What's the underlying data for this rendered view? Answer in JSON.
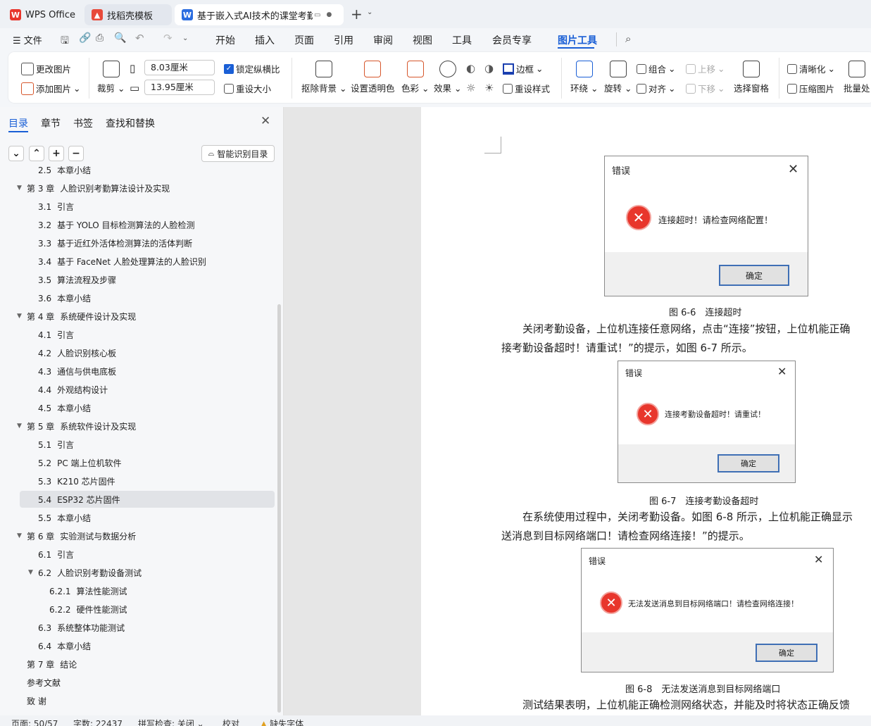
{
  "tabs": [
    {
      "label": "WPS Office",
      "icon": "wps-logo-icon"
    },
    {
      "label": "找稻壳模板",
      "icon": "docer-icon"
    },
    {
      "label": "基于嵌入式AI技术的课堂考勤",
      "icon": "word-doc-icon"
    }
  ],
  "menu": [
    "文件",
    "开始",
    "插入",
    "页面",
    "引用",
    "审阅",
    "视图",
    "工具",
    "会员专享",
    "图片工具"
  ],
  "ribbon": {
    "change_image": "更改图片",
    "add_image": "添加图片",
    "crop": "裁剪",
    "width": "8.03厘米",
    "height": "13.95厘米",
    "lock_ratio": "锁定纵横比",
    "reset_size": "重设大小",
    "remove_bg": "抠除背景",
    "set_transparent": "设置透明色",
    "color": "色彩",
    "effect": "效果",
    "border": "边框",
    "reset_style": "重设样式",
    "wrap": "环绕",
    "rotate": "旋转",
    "group": "组合",
    "align": "对齐",
    "bring_forward": "上移",
    "send_backward": "下移",
    "selection_pane": "选择窗格",
    "sharpen": "清晰化",
    "compress": "压缩图片",
    "batch": "批量处"
  },
  "sidebar": {
    "tabs": [
      "目录",
      "章节",
      "书签",
      "查找和替换"
    ],
    "smart_btn": "智能识别目录",
    "items": [
      {
        "num": "2.5",
        "text": "本章小结",
        "level": 1
      },
      {
        "num": "第 3 章",
        "text": "人脸识别考勤算法设计及实现",
        "level": 0,
        "expanded": true
      },
      {
        "num": "3.1",
        "text": "引言",
        "level": 1
      },
      {
        "num": "3.2",
        "text": "基于 YOLO 目标检测算法的人脸检测",
        "level": 1
      },
      {
        "num": "3.3",
        "text": "基于近红外活体检测算法的活体判断",
        "level": 1
      },
      {
        "num": "3.4",
        "text": "基于 FaceNet 人脸处理算法的人脸识别",
        "level": 1
      },
      {
        "num": "3.5",
        "text": "算法流程及步骤",
        "level": 1
      },
      {
        "num": "3.6",
        "text": "本章小结",
        "level": 1
      },
      {
        "num": "第 4 章",
        "text": "系统硬件设计及实现",
        "level": 0,
        "expanded": true
      },
      {
        "num": "4.1",
        "text": "引言",
        "level": 1
      },
      {
        "num": "4.2",
        "text": "人脸识别核心板",
        "level": 1
      },
      {
        "num": "4.3",
        "text": "通信与供电底板",
        "level": 1
      },
      {
        "num": "4.4",
        "text": "外观结构设计",
        "level": 1
      },
      {
        "num": "4.5",
        "text": "本章小结",
        "level": 1
      },
      {
        "num": "第 5 章",
        "text": "系统软件设计及实现",
        "level": 0,
        "expanded": true
      },
      {
        "num": "5.1",
        "text": "引言",
        "level": 1
      },
      {
        "num": "5.2",
        "text": "PC 端上位机软件",
        "level": 1
      },
      {
        "num": "5.3",
        "text": "K210 芯片固件",
        "level": 1
      },
      {
        "num": "5.4",
        "text": "ESP32 芯片固件",
        "level": 1,
        "selected": true
      },
      {
        "num": "5.5",
        "text": "本章小结",
        "level": 1
      },
      {
        "num": "第 6 章",
        "text": "实验测试与数据分析",
        "level": 0,
        "expanded": true
      },
      {
        "num": "6.1",
        "text": "引言",
        "level": 1
      },
      {
        "num": "6.2",
        "text": "人脸识别考勤设备测试",
        "level": 1,
        "expanded": true
      },
      {
        "num": "6.2.1",
        "text": "算法性能测试",
        "level": 2
      },
      {
        "num": "6.2.2",
        "text": "硬件性能测试",
        "level": 2
      },
      {
        "num": "6.3",
        "text": "系统整体功能测试",
        "level": 1
      },
      {
        "num": "6.4",
        "text": "本章小结",
        "level": 1
      },
      {
        "num": "第 7 章",
        "text": "结论",
        "level": 0
      },
      {
        "num": "",
        "text": "参考文献",
        "level": 0
      },
      {
        "num": "",
        "text": "致 谢",
        "level": 0
      }
    ]
  },
  "doc": {
    "dialogs": [
      {
        "title": "错误",
        "message": "连接超时！请检查网络配置！",
        "ok": "确定"
      },
      {
        "title": "错误",
        "message": "连接考勤设备超时！请重试！",
        "ok": "确定"
      },
      {
        "title": "错误",
        "message": "无法发送消息到目标网络端口！请检查网络连接！",
        "ok": "确定"
      }
    ],
    "captions": [
      "图 6-6　连接超时",
      "图 6-7　连接考勤设备超时",
      "图 6-8　无法发送消息到目标网络端口"
    ],
    "para1a": "关闭考勤设备，上位机连接任意网络，点击“连接”按钮，上位机能正确",
    "para1b": "接考勤设备超时！请重试！”的提示，如图 6-7 所示。",
    "para2a": "在系统使用过程中，关闭考勤设备。如图 6-8 所示，上位机能正确显示",
    "para2b": "送消息到目标网络端口！请检查网络连接！”的提示。",
    "para3a": "测试结果表明，上位机能正确检测网络状态，并能及时将状态正确反馈"
  },
  "status": {
    "page": "页面: 50/57",
    "words": "字数: 22437",
    "spell": "拼写检查: 关闭",
    "proof": "校对",
    "font": "缺失字体"
  },
  "colors": {
    "accent": "#1a5fd6",
    "error_red": "#e8362c",
    "ok_border": "#3f6fb5"
  }
}
